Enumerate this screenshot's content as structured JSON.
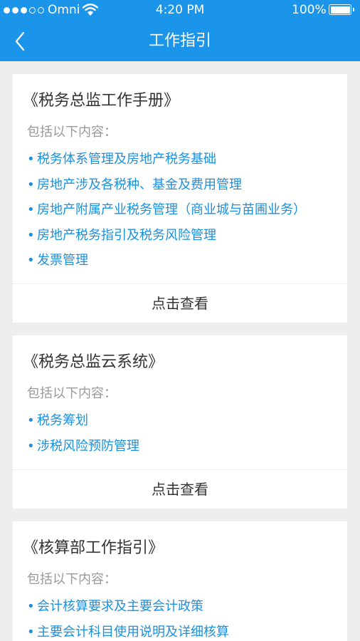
{
  "status_bar": {
    "carrier": "Omni",
    "time": "4:20 PM",
    "battery": "100%"
  },
  "nav": {
    "title": "工作指引"
  },
  "cards": [
    {
      "title": "《税务总监工作手册》",
      "subtitle": "包括以下内容：",
      "items": [
        "税务体系管理及房地产税务基础",
        "房地产涉及各税种、基金及费用管理",
        "房地产附属产业税务管理（商业城与苗圃业务）",
        "房地产税务指引及税务风险管理",
        "发票管理"
      ],
      "button": "点击查看"
    },
    {
      "title": "《税务总监云系统》",
      "subtitle": "包括以下内容：",
      "items": [
        "税务筹划",
        "涉税风险预防管理"
      ],
      "button": "点击查看"
    },
    {
      "title": "《核算部工作指引》",
      "subtitle": "包括以下内容：",
      "items": [
        "会计核算要求及主要会计政策",
        "主要会计科目使用说明及详细核算"
      ]
    }
  ],
  "icons": {
    "signal": "signal-dots-icon",
    "wifi": "wifi-icon",
    "battery": "battery-icon",
    "back": "chevron-left-icon",
    "bullet": "•"
  },
  "colors": {
    "header": "#1a95ea",
    "link": "#1a90e0",
    "background": "#eeeeee"
  }
}
